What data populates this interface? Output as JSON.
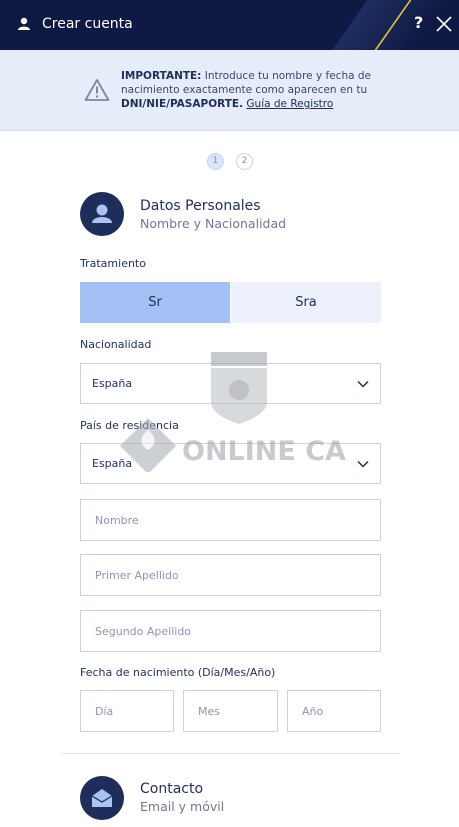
{
  "header": {
    "title": "Crear cuenta",
    "help_label": "?",
    "icons": {
      "user": "user-icon",
      "close": "close-icon"
    }
  },
  "notice": {
    "bold_prefix": "IMPORTANTE:",
    "text_part": " Introduce tu nombre y fecha de nacimiento exactamente como aparecen en tu ",
    "bold_doc": "DNI/NIE/PASAPORTE.",
    "link": "Guía de Registro",
    "icon": "warning-icon"
  },
  "steps": [
    "1",
    "2"
  ],
  "personal": {
    "title": "Datos Personales",
    "subtitle": "Nombre y Nacionalidad",
    "icon": "person-icon"
  },
  "tratamiento": {
    "label": "Tratamiento",
    "options": [
      "Sr",
      "Sra"
    ],
    "selected": "Sr"
  },
  "nacionalidad": {
    "label": "Nacionalidad",
    "value": "España"
  },
  "residencia": {
    "label": "País de residencia",
    "value": "España"
  },
  "fields": {
    "nombre": "Nombre",
    "primer_apellido": "Primer Apellido",
    "segundo_apellido": "Segundo Apellido"
  },
  "birth": {
    "label": "Fecha de nacimiento (Día/Mes/Año)",
    "dia": "Día",
    "mes": "Mes",
    "ano": "Año"
  },
  "contact": {
    "title": "Contacto",
    "subtitle": "Email y móvil",
    "icon": "envelope-icon"
  },
  "watermark": {
    "text": "ONLINE CASINO"
  },
  "colors": {
    "header_bg": "#0f1a44",
    "accent_selected": "#a3c1f5",
    "notice_bg": "#e6ecf8",
    "primary": "#1f2d5a"
  }
}
